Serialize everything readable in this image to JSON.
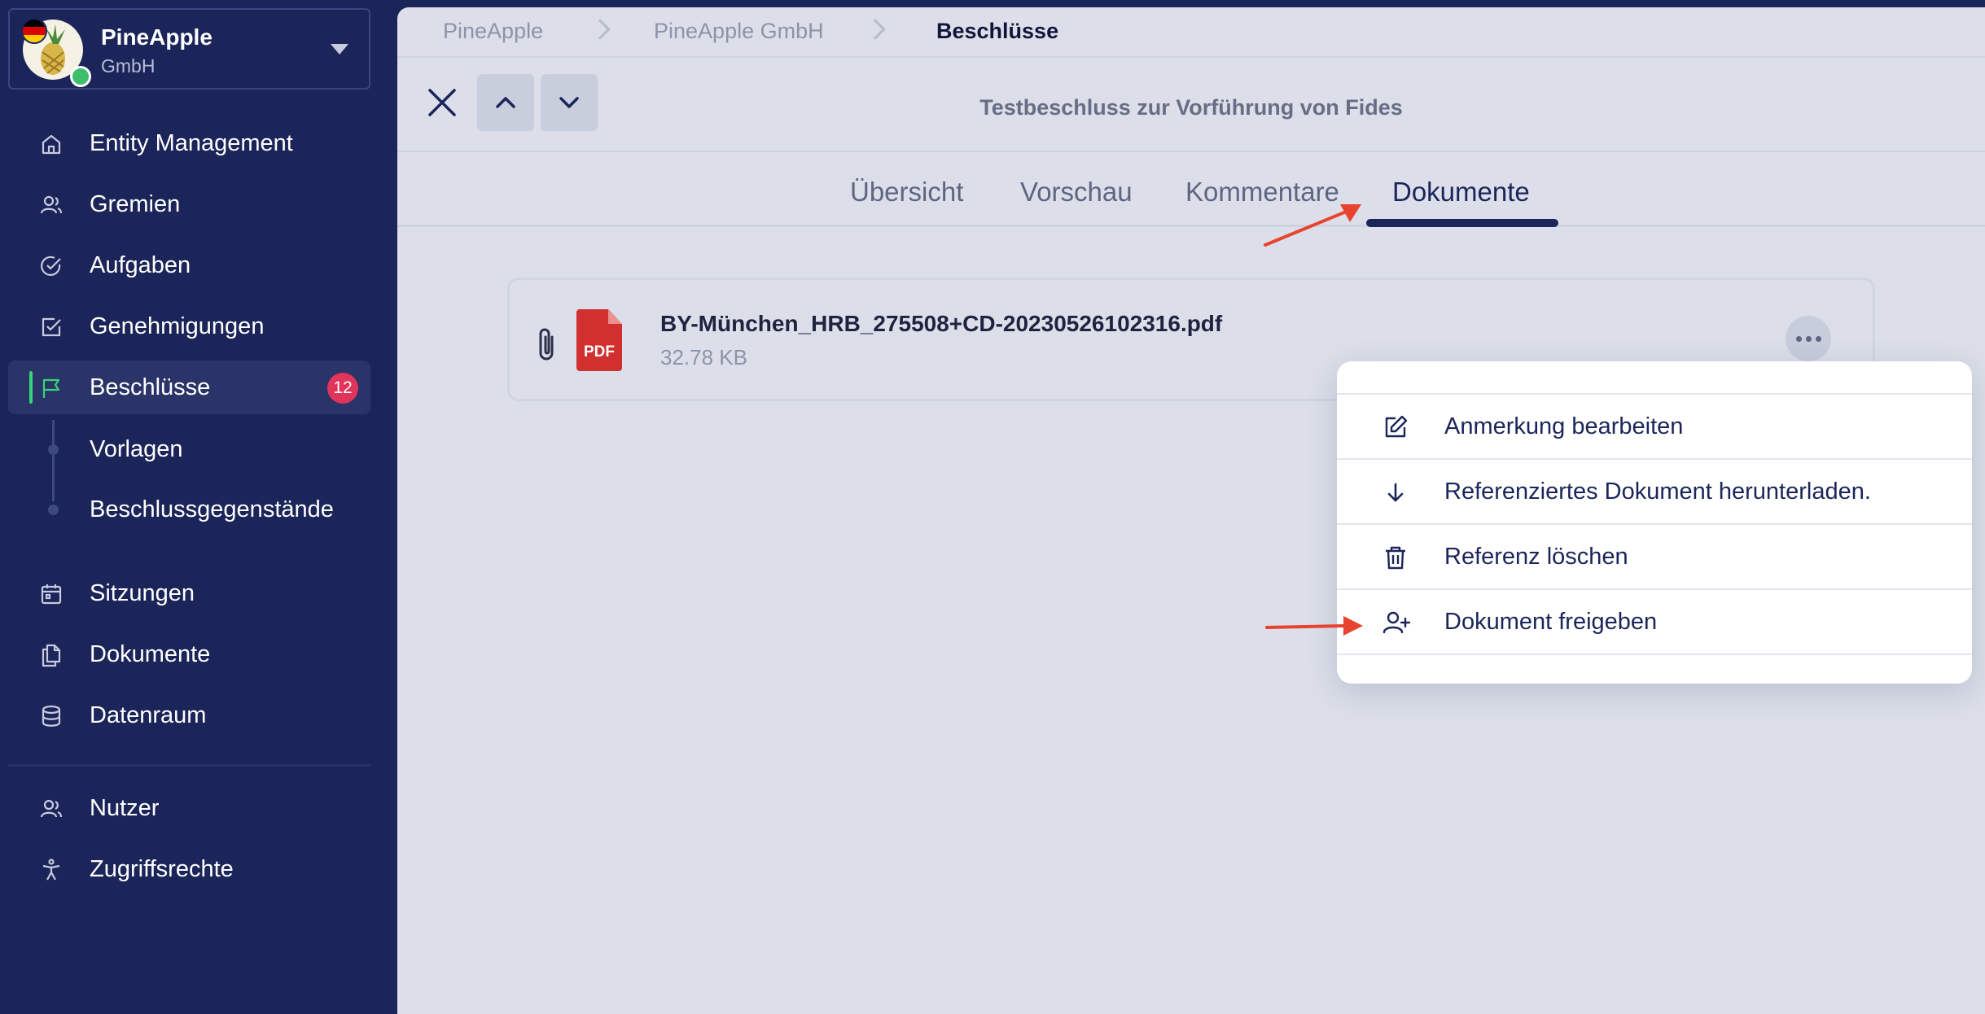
{
  "entity": {
    "name": "PineApple",
    "type": "GmbH"
  },
  "sidebar": {
    "items": [
      {
        "label": "Entity Management",
        "icon": "home-icon"
      },
      {
        "label": "Gremien",
        "icon": "users-icon"
      },
      {
        "label": "Aufgaben",
        "icon": "check-circle-icon"
      },
      {
        "label": "Genehmigungen",
        "icon": "check-square-icon"
      },
      {
        "label": "Beschlüsse",
        "icon": "flag-icon",
        "badge": "12",
        "active": true
      },
      {
        "label": "Sitzungen",
        "icon": "calendar-icon"
      },
      {
        "label": "Dokumente",
        "icon": "documents-icon"
      },
      {
        "label": "Datenraum",
        "icon": "database-icon"
      },
      {
        "label": "Nutzer",
        "icon": "users-icon"
      },
      {
        "label": "Zugriffsrechte",
        "icon": "accessibility-icon"
      }
    ],
    "sub_items": [
      {
        "label": "Vorlagen"
      },
      {
        "label": "Beschlussgegenstände"
      }
    ]
  },
  "breadcrumb": [
    "PineApple",
    "PineApple GmbH",
    "Beschlüsse"
  ],
  "toolbar": {
    "title": "Testbeschluss zur Vorführung von Fides"
  },
  "tabs": [
    {
      "label": "Übersicht"
    },
    {
      "label": "Vorschau"
    },
    {
      "label": "Kommentare"
    },
    {
      "label": "Dokumente",
      "active": true
    }
  ],
  "file": {
    "name": "BY-München_HRB_275508+CD-20230526102316.pdf",
    "size": "32.78 KB",
    "type_label": "PDF"
  },
  "menu": {
    "items": [
      {
        "label": "Anmerkung bearbeiten",
        "icon": "edit-icon"
      },
      {
        "label": "Referenziertes Dokument herunterladen.",
        "icon": "arrow-down-icon"
      },
      {
        "label": "Referenz löschen",
        "icon": "trash-icon"
      },
      {
        "label": "Dokument freigeben",
        "icon": "user-plus-icon"
      }
    ]
  },
  "colors": {
    "sidebar_bg": "#1b2559",
    "main_bg": "#dcdfe9",
    "accent_green": "#38d37b",
    "badge_red": "#e0345a",
    "pdf_red": "#d22f2f",
    "annotation_arrow": "#e8432e"
  }
}
